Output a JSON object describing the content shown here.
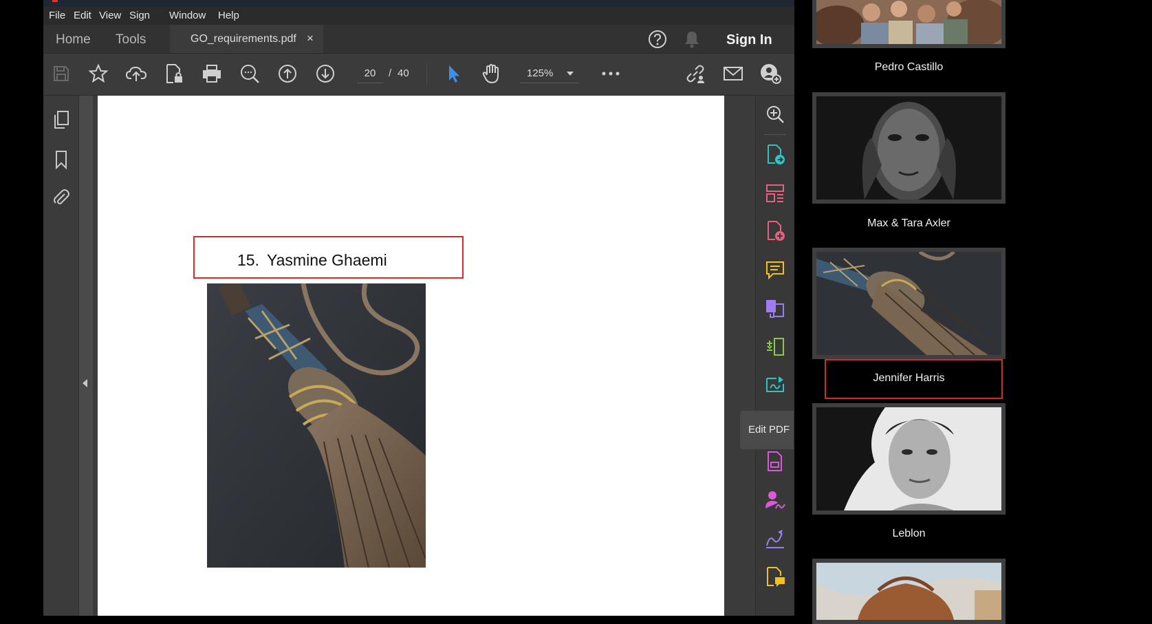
{
  "menu": [
    "File",
    "Edit",
    "View",
    "Sign",
    "Window",
    "Help"
  ],
  "tabs": {
    "home": "Home",
    "tools": "Tools",
    "document": "GO_requirements.pdf",
    "close_glyph": "×"
  },
  "header": {
    "sign_in": "Sign In"
  },
  "toolbar": {
    "current_page": "20",
    "separator": "/",
    "total_pages": "40",
    "zoom": "125%"
  },
  "document": {
    "item_number": "15.",
    "item_name": "Yasmine Ghaemi"
  },
  "tooltip": "Edit PDF",
  "gallery": [
    {
      "caption": "Pedro Castillo"
    },
    {
      "caption": "Max & Tara Axler"
    },
    {
      "caption": "Jennifer Harris",
      "highlighted": true
    },
    {
      "caption": "Leblon"
    }
  ],
  "icons": {
    "left_panel": [
      "pages-icon",
      "bookmark-icon",
      "attachment-icon"
    ],
    "right_tools": [
      "zoom-in-icon",
      "export-pdf-icon",
      "organize-pages-icon",
      "create-pdf-icon",
      "comment-icon",
      "combine-files-icon",
      "compress-icon",
      "send-for-signature-icon",
      "edit-pdf-icon",
      "scan-icon",
      "fill-sign-icon",
      "request-signature-icon",
      "sticky-note-icon"
    ]
  },
  "colors": {
    "accent_red": "#d12b2b",
    "select_tool_blue": "#3d8fe6",
    "tool_teal": "#2fc4c4",
    "tool_pink": "#e8607f",
    "tool_yellow": "#f1c21b",
    "tool_purple": "#9e7df0",
    "tool_green": "#8ccb3f",
    "tool_magenta": "#d75bd7"
  }
}
